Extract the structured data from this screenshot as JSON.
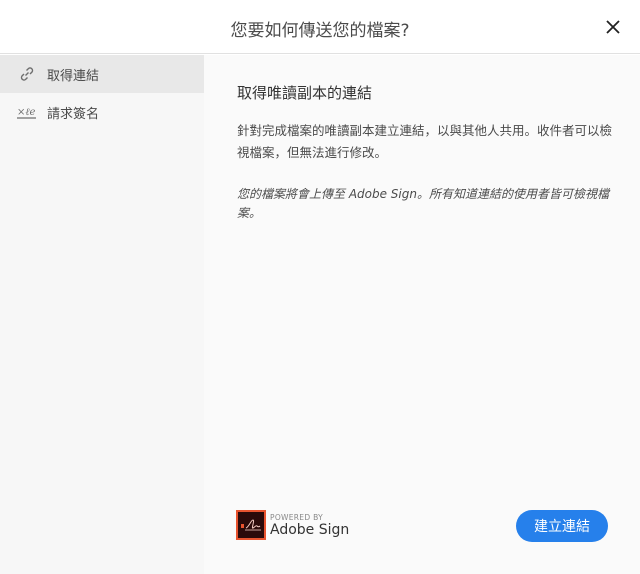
{
  "dialog": {
    "title": "您要如何傳送您的檔案?"
  },
  "sidebar": {
    "items": [
      {
        "label": "取得連結",
        "icon": "link-icon",
        "selected": true
      },
      {
        "label": "請求簽名",
        "icon": "signature-icon",
        "selected": false
      }
    ]
  },
  "main": {
    "heading": "取得唯讀副本的連結",
    "description": "針對完成檔案的唯讀副本建立連結，以與其他人共用。收件者可以檢視檔案，但無法進行修改。",
    "note": "您的檔案將會上傳至 Adobe Sign。所有知道連結的使用者皆可檢視檔案。"
  },
  "footer": {
    "powered_by": "POWERED BY",
    "brand": "Adobe Sign",
    "create_button": "建立連結"
  },
  "colors": {
    "accent": "#2680eb",
    "logo_border": "#e8532f"
  }
}
